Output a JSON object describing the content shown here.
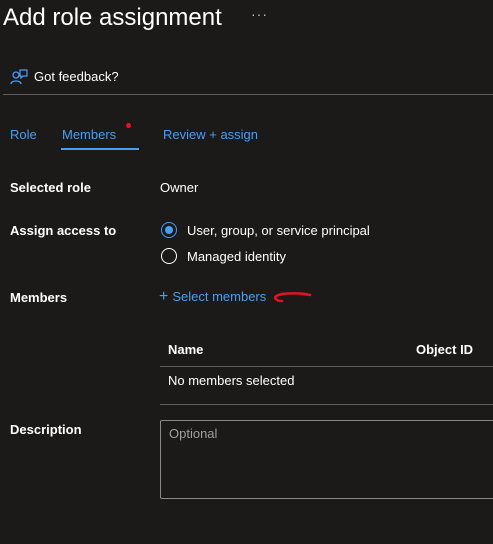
{
  "header": {
    "title": "Add role assignment",
    "more": "···"
  },
  "feedback": {
    "label": "Got feedback?",
    "icon": "feedback-person-icon"
  },
  "tabs": [
    {
      "label": "Role"
    },
    {
      "label": "Members",
      "active": true,
      "has_indicator": true
    },
    {
      "label": "Review + assign"
    }
  ],
  "form": {
    "selected_role": {
      "label": "Selected role",
      "value": "Owner"
    },
    "assign_access": {
      "label": "Assign access to",
      "options": [
        {
          "label": "User, group, or service principal",
          "selected": true
        },
        {
          "label": "Managed identity",
          "selected": false
        }
      ]
    },
    "members": {
      "label": "Members",
      "select_link": "Select members",
      "columns": [
        "Name",
        "Object ID"
      ],
      "empty_text": "No members selected"
    },
    "description": {
      "label": "Description",
      "placeholder": "Optional"
    }
  },
  "colors": {
    "accent": "#479ef5",
    "background": "#1b1a19",
    "annotation": "#e81123"
  }
}
